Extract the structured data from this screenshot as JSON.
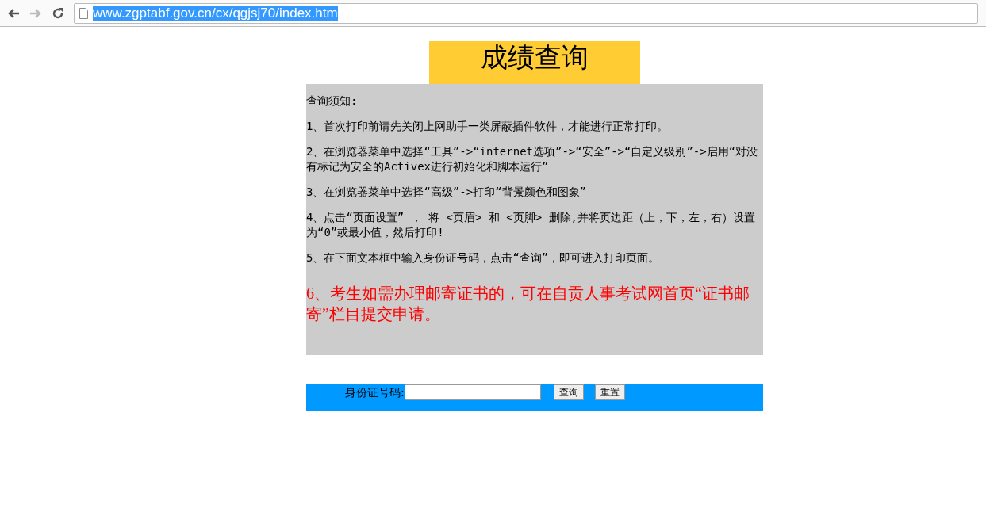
{
  "browser": {
    "address": "www.zgptabf.gov.cn/cx/qgjsj70/index.htm"
  },
  "title": "成绩查询",
  "notice": {
    "heading": "查询须知:",
    "items": [
      {
        "kind": "normal",
        "text": "1、首次打印前请先关闭上网助手一类屏蔽插件软件，才能进行正常打印。"
      },
      {
        "kind": "normal",
        "text": "2、在浏览器菜单中选择“工具”->“internet选项”->“安全”->“自定义级别”->启用“对没有标记为安全的Activex进行初始化和脚本运行”"
      },
      {
        "kind": "normal",
        "text": "3、在浏览器菜单中选择“高级”->打印“背景颜色和图象”"
      },
      {
        "kind": "normal",
        "text": "4、点击“页面设置” ， 将 <页眉> 和 <页脚> 删除,并将页边距（上，下，左，右）设置为“0”或最小值，然后打印!"
      },
      {
        "kind": "normal",
        "text": "5、在下面文本框中输入身份证号码，点击“查询”，即可进入打印页面。"
      },
      {
        "kind": "important",
        "text": "6、考生如需办理邮寄证书的，可在自贡人事考试网首页“证书邮寄”栏目提交申请。"
      }
    ]
  },
  "form": {
    "label": "身份证号码:",
    "buttons": [
      "查询",
      "重置"
    ]
  }
}
